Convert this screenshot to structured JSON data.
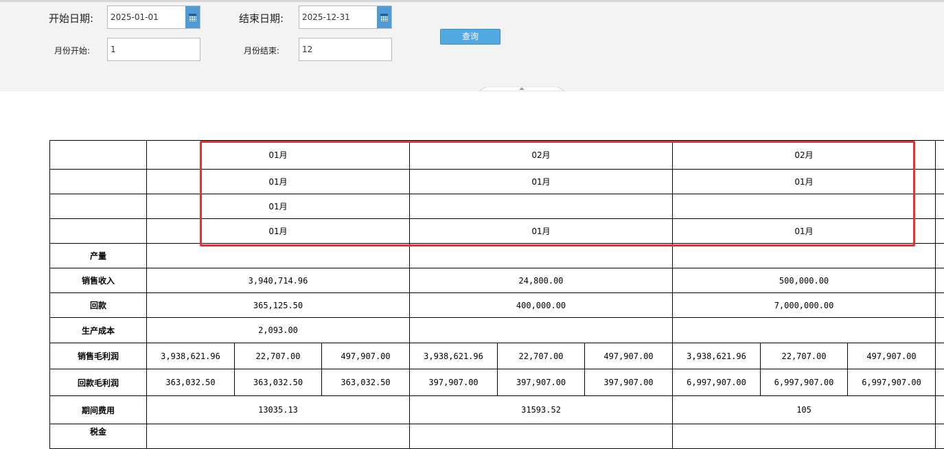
{
  "filters": {
    "start_date_label": "开始日期:",
    "start_date_value": "2025-01-01",
    "end_date_label": "结束日期:",
    "end_date_value": "2025-12-31",
    "month_start_label": "月份开始:",
    "month_start_value": "1",
    "month_end_label": "月份结束:",
    "month_end_value": "12",
    "query_button": "查询"
  },
  "report": {
    "header_rows": [
      [
        "01月",
        "02月",
        "02月"
      ],
      [
        "01月",
        "01月",
        "01月"
      ],
      [
        "01月",
        "",
        ""
      ],
      [
        "01月",
        "01月",
        "01月"
      ]
    ],
    "rows": {
      "output": {
        "label": "产量",
        "values": [
          "",
          "",
          ""
        ]
      },
      "sales_revenue": {
        "label": "销售收入",
        "values": [
          "3,940,714.96",
          "24,800.00",
          "500,000.00"
        ]
      },
      "collection": {
        "label": "回款",
        "values": [
          "365,125.50",
          "400,000.00",
          "7,000,000.00"
        ]
      },
      "production_cost": {
        "label": "生产成本",
        "values": [
          "2,093.00",
          "",
          ""
        ]
      },
      "sales_gross_profit": {
        "label": "销售毛利润",
        "values": [
          "3,938,621.96",
          "22,707.00",
          "497,907.00",
          "3,938,621.96",
          "22,707.00",
          "497,907.00",
          "3,938,621.96",
          "22,707.00",
          "497,907.00"
        ]
      },
      "collection_gross_profit": {
        "label": "回款毛利润",
        "values": [
          "363,032.50",
          "363,032.50",
          "363,032.50",
          "397,907.00",
          "397,907.00",
          "397,907.00",
          "6,997,907.00",
          "6,997,907.00",
          "6,997,907.00"
        ]
      },
      "period_expense": {
        "label": "期间费用",
        "values": [
          "13035.13",
          "31593.52",
          "105"
        ]
      },
      "partial_row": {
        "label": "税金",
        "values": [
          "",
          "",
          ""
        ]
      }
    }
  },
  "colors": {
    "highlight_box": "#e8302c",
    "query_button": "#52a9e2",
    "header_green": "#1d5f1d"
  },
  "icons": {
    "date_picker": "calendar-icon",
    "collapse": "collapse-arrow-icon"
  }
}
